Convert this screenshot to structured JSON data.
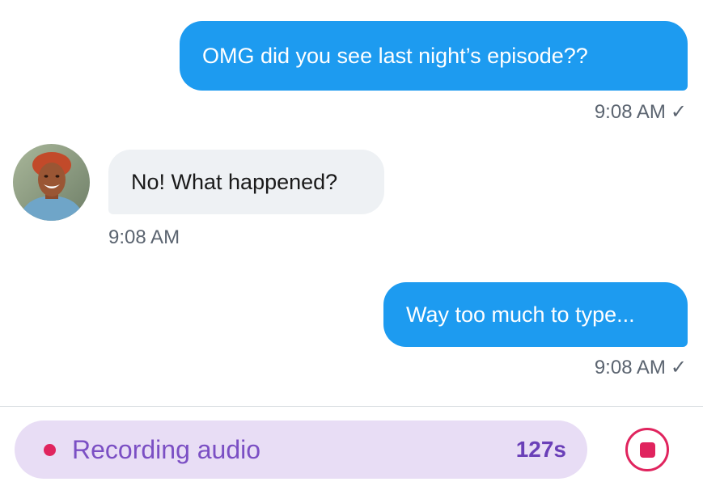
{
  "messages": [
    {
      "direction": "sent",
      "text": "OMG did you see last night’s episode??",
      "time": "9:08 AM",
      "status_icon": "checkmark-icon"
    },
    {
      "direction": "received",
      "text": "No! What happened?",
      "time": "9:08 AM",
      "avatar_icon": "contact-avatar"
    },
    {
      "direction": "sent",
      "text": "Way too much to type...",
      "time": "9:08 AM",
      "status_icon": "checkmark-icon"
    }
  ],
  "status_glyph": "✓",
  "recorder": {
    "label": "Recording audio",
    "duration": "127s",
    "stop_icon": "stop-icon"
  },
  "colors": {
    "sent_bubble": "#1d9bf0",
    "received_bubble": "#eef1f4",
    "recorder_bg": "#e8ddf5",
    "recorder_text": "#7b4fc4",
    "record_red": "#e0245e"
  }
}
